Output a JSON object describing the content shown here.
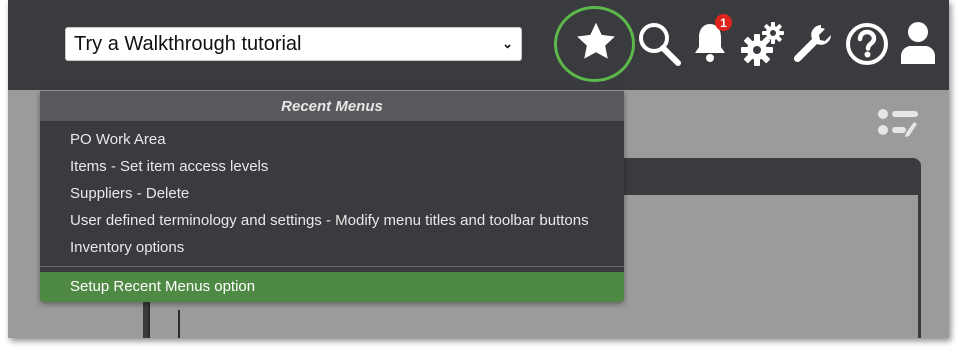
{
  "walkthrough": {
    "selected": "Try a Walkthrough tutorial"
  },
  "notifications": {
    "count": "1"
  },
  "recent_menus": {
    "title": "Recent Menus",
    "items": [
      "PO Work Area",
      "Items - Set item access levels",
      "Suppliers - Delete",
      "User defined terminology and settings - Modify menu titles and toolbar buttons",
      "Inventory options"
    ],
    "footer": "Setup Recent Menus option"
  },
  "colors": {
    "topbar": "#3a3b3f",
    "highlight_ring": "#5cb84a",
    "footer_green": "#4f8a45",
    "badge_red": "#e0231d"
  },
  "icons": [
    "chevron-down-icon",
    "star-icon",
    "search-icon",
    "bell-icon",
    "gears-icon",
    "wrench-icon",
    "help-icon",
    "user-icon",
    "list-settings-icon"
  ]
}
